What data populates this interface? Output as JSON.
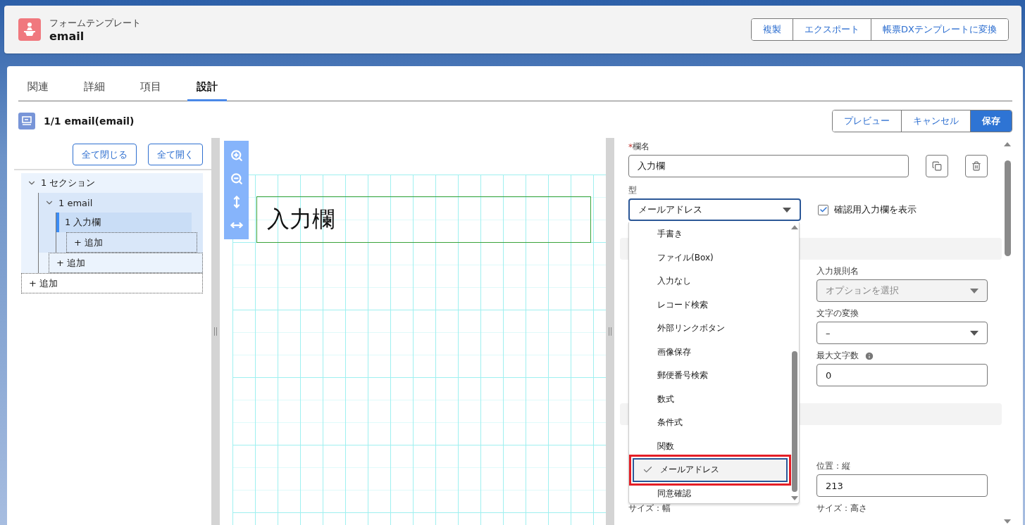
{
  "header": {
    "object_type": "フォームテンプレート",
    "title": "email",
    "actions": [
      "複製",
      "エクスポート",
      "帳票DXテンプレートに変換"
    ]
  },
  "tabs": [
    {
      "label": "関連",
      "selected": false
    },
    {
      "label": "詳細",
      "selected": false
    },
    {
      "label": "項目",
      "selected": false
    },
    {
      "label": "設計",
      "selected": true
    }
  ],
  "page": {
    "title": "1/1 email(email)",
    "actions": [
      {
        "label": "プレビュー",
        "kind": "neutral"
      },
      {
        "label": "キャンセル",
        "kind": "neutral"
      },
      {
        "label": "保存",
        "kind": "brand"
      }
    ]
  },
  "tree": {
    "buttons": [
      "全て閉じる",
      "全て開く"
    ],
    "add": "+ 追加",
    "nodes": [
      {
        "label": "1 セクション",
        "expanded": true,
        "selected": false,
        "add": "+ 追加",
        "children": [
          {
            "label": "1 email",
            "expanded": true,
            "selected": false,
            "add": "+ 追加",
            "children": [
              {
                "label": "1 入力欄",
                "selected": true
              }
            ]
          }
        ]
      }
    ]
  },
  "canvas": {
    "element_text": "入力欄"
  },
  "properties": {
    "name_label": "欄名",
    "required_mark": "*",
    "name_value": "入力欄",
    "type_label": "型",
    "type_value": "メールアドレス",
    "confirm": {
      "label": "確認用入力欄を表示",
      "checked": true
    },
    "type_options": [
      {
        "label": "手書き",
        "selected": false
      },
      {
        "label": "ファイル(Box)",
        "selected": false
      },
      {
        "label": "入力なし",
        "selected": false
      },
      {
        "label": "レコード検索",
        "selected": false
      },
      {
        "label": "外部リンクボタン",
        "selected": false
      },
      {
        "label": "画像保存",
        "selected": false
      },
      {
        "label": "郵便番号検索",
        "selected": false
      },
      {
        "label": "数式",
        "selected": false
      },
      {
        "label": "条件式",
        "selected": false
      },
      {
        "label": "関数",
        "selected": false
      },
      {
        "label": "メールアドレス",
        "selected": true
      },
      {
        "label": "同意確認",
        "selected": false
      }
    ],
    "rows": [
      {
        "kind": "section"
      },
      {
        "kind": "field",
        "right": {
          "label": "入力規則名",
          "kind": "select",
          "placeholder": "オプションを選択",
          "disabled": true
        }
      },
      {
        "kind": "field",
        "right": {
          "label": "文字の変換",
          "kind": "select",
          "value": "–",
          "disabled": false
        }
      },
      {
        "kind": "field",
        "right": {
          "label": "最大文字数",
          "kind": "input",
          "value": "0",
          "info": true
        }
      },
      {
        "kind": "section"
      },
      {
        "kind": "gap"
      },
      {
        "kind": "field",
        "right": {
          "label": "位置：縦",
          "kind": "input",
          "value": "213"
        }
      },
      {
        "kind": "labels",
        "left": {
          "label": "サイズ：幅"
        },
        "right": {
          "label": "サイズ：高さ"
        }
      }
    ]
  }
}
